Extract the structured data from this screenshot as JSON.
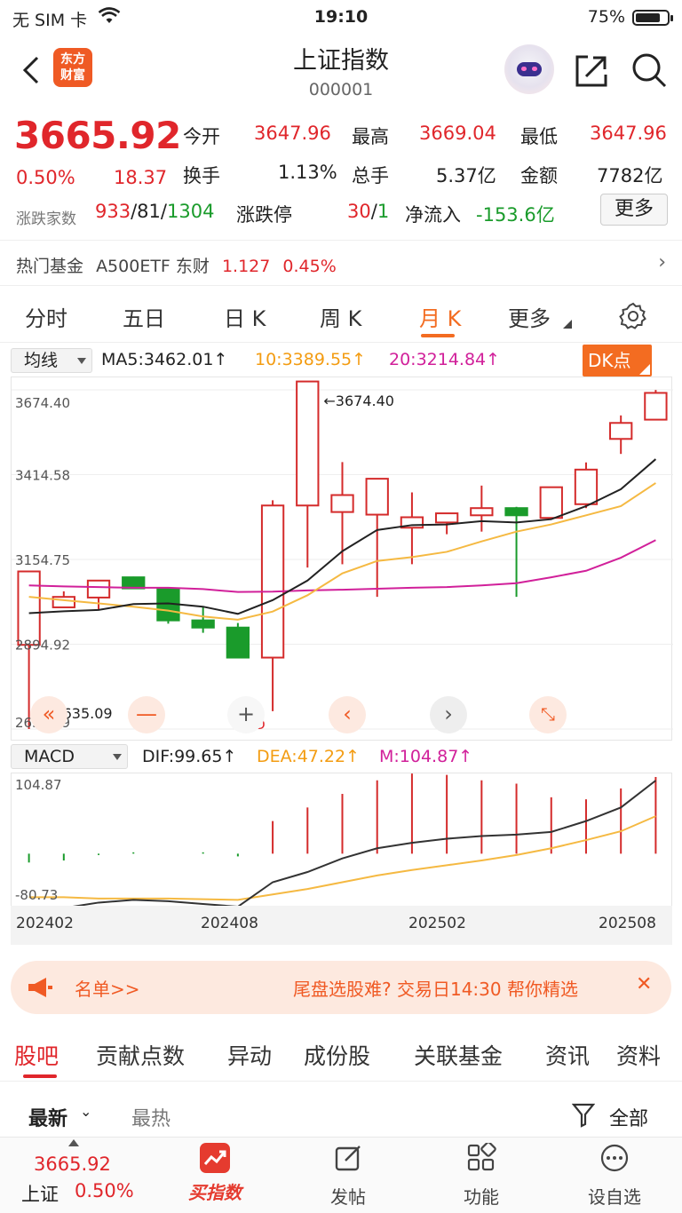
{
  "status_bar": {
    "carrier": "无 SIM 卡",
    "time": "19:10",
    "battery": "75%"
  },
  "header": {
    "logo_line1": "东方",
    "logo_line2": "财富",
    "title": "上证指数",
    "code": "000001"
  },
  "quote": {
    "price": "3665.92",
    "change_pct": "0.50%",
    "change": "18.37",
    "open_label": "今开",
    "open": "3647.96",
    "high_label": "最高",
    "high": "3669.04",
    "low_label": "最低",
    "low": "3647.96",
    "turnover_label": "换手",
    "turnover": "1.13%",
    "volume_label": "总手",
    "volume": "5.37亿",
    "amount_label": "金额",
    "amount": "7782亿",
    "breadth_label": "涨跌家数",
    "breadth_up": "933",
    "sep1": "/",
    "breadth_flat": "81",
    "sep2": "/",
    "breadth_down": "1304",
    "limit_label": "涨跌停",
    "limit_up": "30",
    "sep3": "/",
    "limit_down": "1",
    "netflow_label": "净流入",
    "netflow": "-153.6亿",
    "more_label": "更多"
  },
  "hot_fund": {
    "label": "热门基金",
    "name": "A500ETF 东财",
    "price": "1.127",
    "pct": "0.45%"
  },
  "chart_tabs": [
    "分时",
    "五日",
    "日 K",
    "周 K",
    "月 K",
    "更多"
  ],
  "active_chart_tab": "月 K",
  "ma_row": {
    "select": "均线",
    "ma5": "MA5:3462.01↑",
    "ma10": "10:3389.55↑",
    "ma20": "20:3214.84↑",
    "dk_button": "DK点"
  },
  "colors": {
    "up": "#d42b2b",
    "down": "#1a9b2b",
    "accent": "#f36c21",
    "ma5": "#222222",
    "ma10": "#f5b942",
    "ma20": "#d1209a"
  },
  "chart_data": [
    {
      "type": "candlestick",
      "y_ticks": [
        "3674.40",
        "3414.58",
        "3154.75",
        "2894.92",
        "2635.09"
      ],
      "ylim": [
        2635.09,
        3674.4
      ],
      "high_annotation": "3674.40",
      "low_annotation": "2635.09",
      "candles": [
        {
          "o": 2893,
          "h": 2987,
          "l": 2635,
          "c": 3118
        },
        {
          "o": 3008,
          "h": 3057,
          "l": 3020,
          "c": 3040
        },
        {
          "o": 3038,
          "h": 3088,
          "l": 3002,
          "c": 3090
        },
        {
          "o": 3100,
          "h": 3102,
          "l": 3065,
          "c": 3066
        },
        {
          "o": 3065,
          "h": 3056,
          "l": 2958,
          "c": 2968
        },
        {
          "o": 2968,
          "h": 3008,
          "l": 2930,
          "c": 2946
        },
        {
          "o": 2946,
          "h": 2960,
          "l": 2860,
          "c": 2854
        },
        {
          "o": 2854,
          "h": 3336,
          "l": 2690,
          "c": 3320
        },
        {
          "o": 3320,
          "h": 3674.4,
          "l": 3130,
          "c": 3700
        },
        {
          "o": 3300,
          "h": 3453,
          "l": 3140,
          "c": 3352
        },
        {
          "o": 3292,
          "h": 3400,
          "l": 3040,
          "c": 3402
        },
        {
          "o": 3252,
          "h": 3360,
          "l": 3140,
          "c": 3284
        },
        {
          "o": 3268,
          "h": 3287,
          "l": 3232,
          "c": 3296
        },
        {
          "o": 3290,
          "h": 3381,
          "l": 3240,
          "c": 3312
        },
        {
          "o": 3312,
          "h": 3316,
          "l": 3040,
          "c": 3290
        },
        {
          "o": 3282,
          "h": 3360,
          "l": 3290,
          "c": 3376
        },
        {
          "o": 3324,
          "h": 3452,
          "l": 3312,
          "c": 3430
        },
        {
          "o": 3524,
          "h": 3596,
          "l": 3478,
          "c": 3573
        },
        {
          "o": 3583,
          "h": 3674,
          "l": 3600,
          "c": 3665
        }
      ],
      "ma5": [
        2990,
        2996,
        3000,
        3018,
        3020,
        3010,
        2988,
        3030,
        3090,
        3180,
        3245,
        3260,
        3262,
        3272,
        3268,
        3278,
        3318,
        3370,
        3462
      ],
      "ma10": [
        3040,
        3030,
        3020,
        3010,
        2998,
        2980,
        2970,
        2995,
        3045,
        3112,
        3150,
        3162,
        3178,
        3210,
        3240,
        3262,
        3290,
        3318,
        3389
      ],
      "ma20": [
        3075,
        3072,
        3070,
        3068,
        3068,
        3064,
        3055,
        3056,
        3060,
        3062,
        3065,
        3068,
        3070,
        3075,
        3082,
        3100,
        3120,
        3160,
        3214
      ]
    },
    {
      "type": "macd",
      "y_ticks": [
        "104.87",
        "-80.73"
      ],
      "ylim": [
        -80.73,
        104.87
      ],
      "legend": {
        "select": "MACD",
        "dif": "DIF:99.65↑",
        "dea": "DEA:47.22↑",
        "m": "M:104.87↑"
      },
      "hist": [
        -21,
        -18,
        -10,
        -6,
        -8,
        -6,
        -12,
        40,
        60,
        80,
        100,
        110,
        108,
        100,
        95,
        75,
        72,
        88,
        104.87
      ],
      "dif": [
        -92,
        -88,
        -80,
        -76,
        -78,
        -82,
        -86,
        -50,
        -35,
        -15,
        0,
        8,
        14,
        18,
        20,
        24,
        40,
        60,
        99.65
      ],
      "dea": [
        -72,
        -72,
        -74,
        -74,
        -74,
        -75,
        -76,
        -68,
        -60,
        -50,
        -40,
        -32,
        -25,
        -18,
        -10,
        0,
        12,
        25,
        47.22
      ],
      "x_labels": [
        "202402",
        "202408",
        "202502",
        "202508"
      ]
    }
  ],
  "banner": {
    "left": "名单>>",
    "right": "尾盘选股难? 交易日14:30 帮你精选"
  },
  "sub_tabs": [
    "股吧",
    "贡献点数",
    "异动",
    "成份股",
    "关联基金",
    "资讯",
    "资料"
  ],
  "sort": {
    "latest": "最新",
    "hot": "最热",
    "filter": "全部"
  },
  "tabbar": {
    "index_price": "3665.92",
    "index_name": "上证",
    "index_pct": "0.50%",
    "buy": "买指数",
    "post": "发帖",
    "func": "功能",
    "watch": "设自选"
  }
}
